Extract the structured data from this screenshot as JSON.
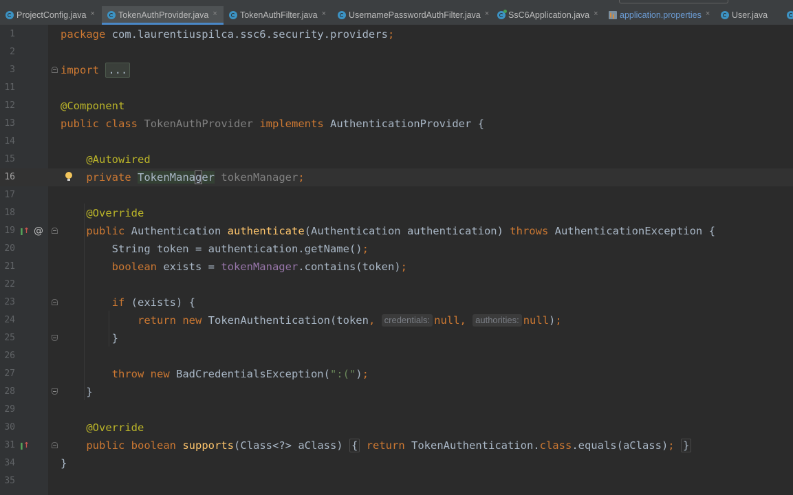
{
  "tabs": [
    {
      "label": "ProjectConfig.java",
      "active": false,
      "icon": "class-icon"
    },
    {
      "label": "TokenAuthProvider.java",
      "active": true,
      "icon": "class-icon"
    },
    {
      "label": "TokenAuthFilter.java",
      "active": false,
      "icon": "class-icon"
    },
    {
      "label": "UsernamePasswordAuthFilter.java",
      "active": false,
      "icon": "class-icon"
    },
    {
      "label": "SsC6Application.java",
      "active": false,
      "icon": "runnable-class-icon"
    },
    {
      "label": "application.properties",
      "active": false,
      "icon": "properties-file-icon"
    },
    {
      "label": "User.java",
      "active": false,
      "icon": "class-icon"
    }
  ],
  "tab_close_glyph": "×",
  "code": {
    "line_numbers": [
      "1",
      "2",
      "3",
      "11",
      "12",
      "13",
      "14",
      "15",
      "16",
      "17",
      "18",
      "19",
      "20",
      "21",
      "22",
      "23",
      "24",
      "25",
      "26",
      "27",
      "28",
      "29",
      "30",
      "31",
      "34",
      "35"
    ],
    "l1": {
      "kw": "package",
      "rest": " com.laurentiuspilca.ssc6.security.providers",
      "semi": ";"
    },
    "l3": {
      "kw": "import",
      "folded": "..."
    },
    "l12": {
      "ann": "@Component"
    },
    "l13": {
      "kw1": "public",
      "kw2": "class",
      "name": "TokenAuthProvider",
      "kw3": "implements",
      "iface": "AuthenticationProvider",
      "brace": " {"
    },
    "l15": {
      "ann": "@Autowired"
    },
    "l16": {
      "kw": "private",
      "type_a": "TokenMana",
      "type_cursor": "g",
      "type_b": "er",
      "field": "tokenManager",
      "semi": ";"
    },
    "l18": {
      "ann": "@Override"
    },
    "l19": {
      "kw1": "public",
      "type": "Authentication",
      "method": "authenticate",
      "params": "(Authentication authentication) ",
      "kw2": "throws",
      "exc": " AuthenticationException {"
    },
    "l20": {
      "text": "String token = authentication.getName()",
      "semi": ";"
    },
    "l21": {
      "kw": "boolean",
      "pre": " exists = ",
      "field": "tokenManager",
      "post": ".contains(token)",
      "semi": ";"
    },
    "l23": {
      "kw": "if",
      "rest": " (exists) {"
    },
    "l24": {
      "kw1": "return",
      "kw2": "new",
      "call": " TokenAuthentication(token",
      "comma1": ", ",
      "hint1": "credentials:",
      "null1": "null",
      "comma2": ", ",
      "hint2": "authorities:",
      "null2": "null",
      "close": ")",
      "semi": ";"
    },
    "l25": {
      "text": "}"
    },
    "l27": {
      "kw1": "throw",
      "kw2": "new",
      "call": " BadCredentialsException(",
      "str": "\":(\"",
      "close": ")",
      "semi": ";"
    },
    "l28": {
      "text": "}"
    },
    "l30": {
      "ann": "@Override"
    },
    "l31": {
      "kw1": "public",
      "kw2": "boolean",
      "method": "supports",
      "params": "(Class<?> aClass) ",
      "brace_open": "{",
      "kw3": "return",
      "mid": " TokenAuthentication.",
      "kw4": "class",
      "post": ".equals(aClass)",
      "semi": ";",
      "brace_close": "}"
    },
    "l34": {
      "text": "}"
    }
  },
  "colors": {
    "background": "#2b2b2b",
    "keyword": "#cc7832",
    "annotation": "#bbb529",
    "method": "#ffc66d",
    "field": "#9876aa",
    "string": "#6a8759",
    "text": "#a9b7c6",
    "accent_tab_underline": "#4a88c7"
  }
}
